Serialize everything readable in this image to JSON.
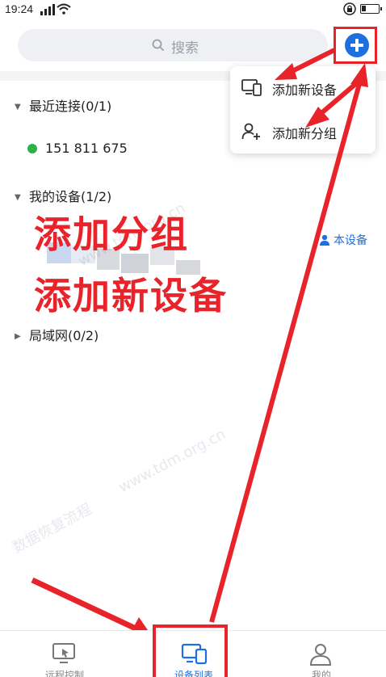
{
  "status_bar": {
    "time": "19:24",
    "signal_icon": "signal-icon",
    "wifi_icon": "wifi-icon",
    "lock_icon": "lock-icon",
    "battery_icon": "battery-icon"
  },
  "search": {
    "placeholder": "搜索",
    "icon": "search-icon"
  },
  "header": {
    "add_button_icon": "plus-circle-icon"
  },
  "popup_menu": {
    "items": [
      {
        "label": "添加新设备",
        "icon": "devices-icon"
      },
      {
        "label": "添加新分组",
        "icon": "add-user-icon"
      }
    ]
  },
  "sections": {
    "recent": {
      "label": "最近连接(0/1)",
      "expanded": true
    },
    "mine": {
      "label": "我的设备(1/2)",
      "expanded": true
    },
    "lan": {
      "label": "局域网(0/2)",
      "expanded": false
    }
  },
  "recent_devices": [
    {
      "id": "151 811 675",
      "status_color": "#2bb34a"
    }
  ],
  "my_device_tag": {
    "label": "本设备",
    "icon": "person-icon"
  },
  "overlay_annotation": {
    "line1": "添加分组",
    "line2": "添加新设备",
    "color": "#e8232a"
  },
  "watermarks": [
    "www.tdm.org.cn",
    "www.tdm.org.cn",
    "数据恢复流程"
  ],
  "tab_bar": {
    "tabs": [
      {
        "label": "远程控制",
        "icon": "remote-desktop-icon",
        "active": false
      },
      {
        "label": "设备列表",
        "icon": "devices-icon",
        "active": true
      },
      {
        "label": "我的",
        "icon": "profile-icon",
        "active": false
      }
    ]
  },
  "colors": {
    "accent": "#1e6fe0",
    "annotation_red": "#e8232a",
    "online_green": "#2bb34a",
    "search_bg": "#eef0f4"
  }
}
